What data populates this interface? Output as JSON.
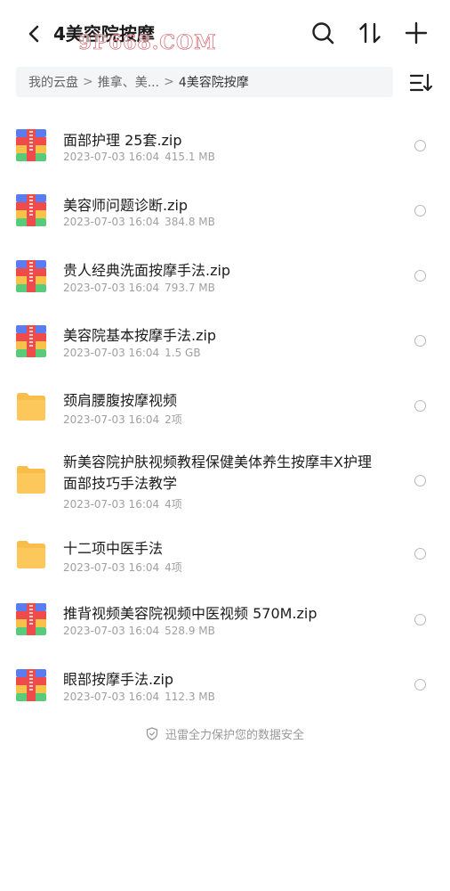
{
  "header": {
    "title": "4美容院按摩",
    "watermark": "9P668.COM"
  },
  "breadcrumb": {
    "root": "我的云盘",
    "sep1": ">",
    "middle": "推拿、美...",
    "sep2": ">",
    "current": "4美容院按摩"
  },
  "files": [
    {
      "name": "面部护理 25套.zip",
      "date": "2023-07-03 16:04",
      "size": "415.1 MB",
      "type": "zip"
    },
    {
      "name": "美容师问题诊断.zip",
      "date": "2023-07-03 16:04",
      "size": "384.8 MB",
      "type": "zip"
    },
    {
      "name": "贵人经典洗面按摩手法.zip",
      "date": "2023-07-03 16:04",
      "size": "793.7 MB",
      "type": "zip"
    },
    {
      "name": "美容院基本按摩手法.zip",
      "date": "2023-07-03 16:04",
      "size": "1.5 GB",
      "type": "zip"
    },
    {
      "name": "颈肩腰腹按摩视频",
      "date": "2023-07-03 16:04",
      "size": "2项",
      "type": "folder"
    },
    {
      "name": "新美容院护肤视频教程保健美体养生按摩丰X护理面部技巧手法教学",
      "date": "2023-07-03 16:04",
      "size": "4项",
      "type": "folder"
    },
    {
      "name": "十二项中医手法",
      "date": "2023-07-03 16:04",
      "size": "4项",
      "type": "folder"
    },
    {
      "name": "推背视频美容院视频中医视频 570M.zip",
      "date": "2023-07-03 16:04",
      "size": "528.9 MB",
      "type": "zip"
    },
    {
      "name": "眼部按摩手法.zip",
      "date": "2023-07-03 16:04",
      "size": "112.3 MB",
      "type": "zip"
    }
  ],
  "footer": {
    "text": "迅雷全力保护您的数据安全"
  },
  "colors": {
    "folder": "#f9bd4a",
    "zip_blue": "#5b7cf0",
    "zip_red": "#ef4b4b",
    "zip_yellow": "#f7c24a",
    "zip_green": "#59c97a"
  }
}
